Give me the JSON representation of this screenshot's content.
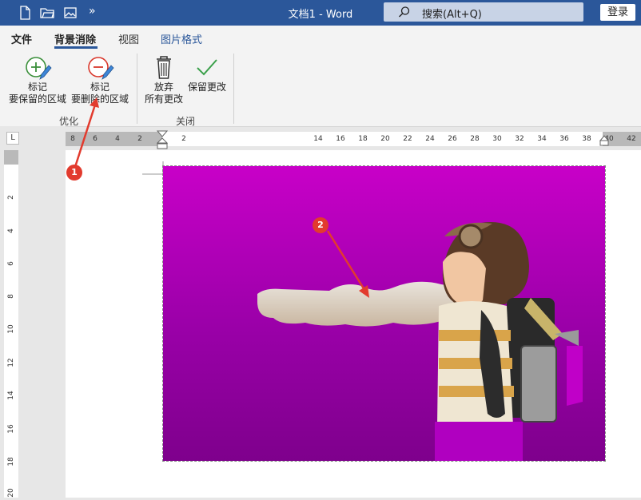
{
  "titlebar": {
    "title": "文档1  -  Word",
    "search_label": "搜索(Alt+Q)",
    "login_label": "登录",
    "overflow_label": "»"
  },
  "tabs": {
    "file": "文件",
    "background_removal": "背景消除",
    "view": "视图",
    "picture_format": "图片格式"
  },
  "ribbon": {
    "mark_keep_line1": "标记",
    "mark_keep_line2": "要保留的区域",
    "mark_remove_line1": "标记",
    "mark_remove_line2": "要删除的区域",
    "group_refine": "优化",
    "discard_line1": "放弃",
    "discard_line2": "所有更改",
    "keep_changes": "保留更改",
    "group_close": "关闭"
  },
  "ruler": {
    "h_ticks": [
      "8",
      "6",
      "4",
      "2",
      "2",
      "14",
      "16",
      "18",
      "20",
      "22",
      "24",
      "26",
      "28",
      "30",
      "32",
      "34",
      "36",
      "38",
      "40",
      "42"
    ],
    "v_ticks": [
      "2",
      "4",
      "6",
      "8",
      "10",
      "12",
      "14",
      "16",
      "18",
      "20"
    ],
    "corner": "L"
  },
  "annotations": [
    "1",
    "2"
  ],
  "colors": {
    "accent": "#2b579a",
    "remove_overlay": "#b000b8",
    "badge": "#e23b2e"
  }
}
